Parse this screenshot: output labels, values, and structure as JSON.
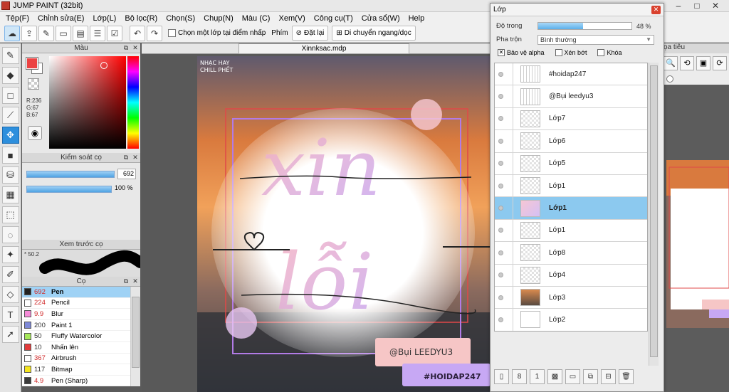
{
  "app": {
    "title": "JUMP PAINT (32bit)"
  },
  "menu": [
    "Tệp(F)",
    "Chỉnh sửa(E)",
    "Lớp(L)",
    "Bộ lọc(R)",
    "Chọn(S)",
    "Chụp(N)",
    "Màu (C)",
    "Xem(V)",
    "Công cụ(T)",
    "Cửa sổ(W)",
    "Help"
  ],
  "toolbar": {
    "select_layer_label": "Chọn một lớp tại điểm nhấp",
    "key_label": "Phím",
    "reset_label": "Đặt lại",
    "move_label": "Di chuyển ngang/dọc"
  },
  "color_panel": {
    "title": "Màu",
    "r": "R:236",
    "g": "G:67",
    "b": "B:67",
    "foreground": "#ec4343"
  },
  "brush_control": {
    "title": "Kiểm soát cọ",
    "size": "692",
    "opacity": "100 %"
  },
  "preview": {
    "title": "Xem trước cọ",
    "size": "50.2"
  },
  "brush_panel": {
    "title": "Cọ",
    "items": [
      {
        "size": "692",
        "name": "Pen",
        "color": "#222222",
        "selected": true,
        "red": true
      },
      {
        "size": "224",
        "name": "Pencil",
        "color": "#ffffff",
        "red": true
      },
      {
        "size": "9.9",
        "name": "Blur",
        "color": "#f58cd8",
        "red": true
      },
      {
        "size": "200",
        "name": "Paint 1",
        "color": "#7f8ad8"
      },
      {
        "size": "50",
        "name": "Fluffy Watercolor",
        "color": "#a6e85a"
      },
      {
        "size": "10",
        "name": "Nhấn lên",
        "color": "#e23b3b"
      },
      {
        "size": "367",
        "name": "Airbrush",
        "color": "#ffffff",
        "red": true
      },
      {
        "size": "117",
        "name": "Bitmap",
        "color": "#f5e51e"
      },
      {
        "size": "4.9",
        "name": "Pen (Sharp)",
        "color": "#3a3a3a",
        "red": true
      }
    ]
  },
  "document": {
    "tab": "Xinnksac.mdp"
  },
  "artwork": {
    "watermark_line1": "NHẠC HAY",
    "watermark_line2": "CHILL PHẾT",
    "credit": "@Bụi LEEDYU3",
    "hashtag": "#HOIDAP247"
  },
  "right_strip": {
    "title": "ọa tiêu"
  },
  "layer_window": {
    "title": "Lớp",
    "opacity_label": "Độ trong",
    "opacity_value": "48 %",
    "opacity_fraction": 0.48,
    "blend_label": "Pha trộn",
    "blend_value": "Bình thường",
    "protect_alpha": "Bảo vệ alpha",
    "clipping": "Xén bớt",
    "lock": "Khóa",
    "layers": [
      {
        "name": "#hoidap247",
        "thumb": "text"
      },
      {
        "name": "@Bụi leedyu3",
        "thumb": "text"
      },
      {
        "name": "Lớp7",
        "thumb": "blank"
      },
      {
        "name": "Lớp6",
        "thumb": "blank"
      },
      {
        "name": "Lớp5",
        "thumb": "blank"
      },
      {
        "name": "Lớp1",
        "thumb": "blank"
      },
      {
        "name": "Lớp1",
        "thumb": "pink",
        "selected": true
      },
      {
        "name": "Lớp1",
        "thumb": "blank"
      },
      {
        "name": "Lớp8",
        "thumb": "blank"
      },
      {
        "name": "Lớp4",
        "thumb": "blank"
      },
      {
        "name": "Lớp3",
        "thumb": "photo"
      },
      {
        "name": "Lớp2",
        "thumb": "white"
      }
    ]
  }
}
